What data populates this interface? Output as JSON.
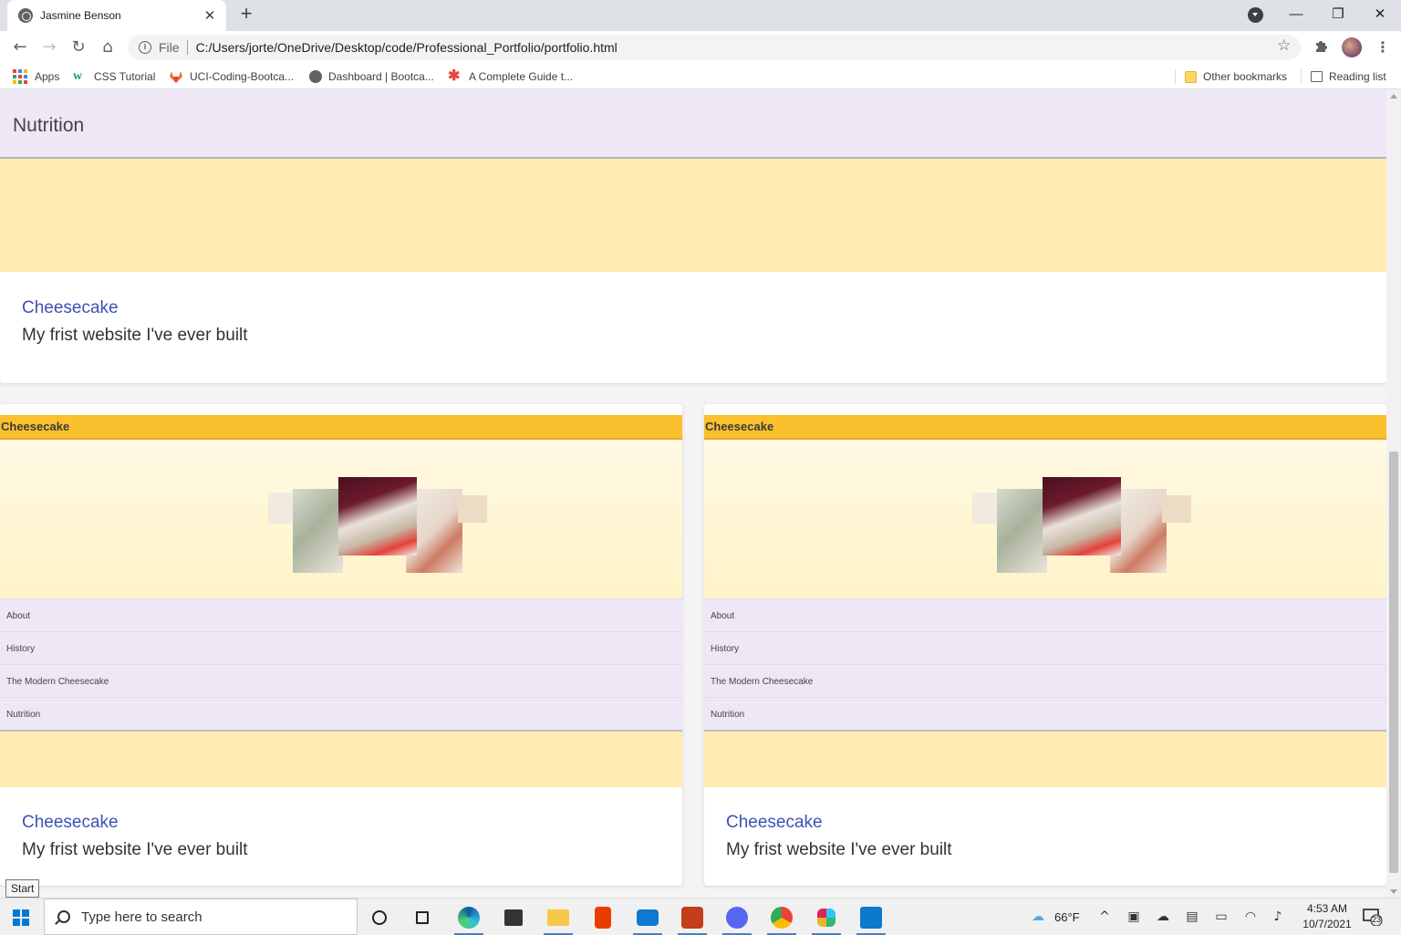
{
  "browser": {
    "tab_title": "Jasmine Benson",
    "tab_close": "✕",
    "new_tab": "+",
    "address_scheme": "File",
    "address_url": "C:/Users/jorte/OneDrive/Desktop/code/Professional_Portfolio/portfolio.html",
    "window_controls": {
      "minimize": "—",
      "restore": "❐",
      "close": "✕"
    }
  },
  "bookmarks": {
    "items": [
      {
        "label": "Apps",
        "icon": "apps-grid-icon"
      },
      {
        "label": "CSS Tutorial",
        "icon": "w3schools-icon"
      },
      {
        "label": "UCI-Coding-Bootca...",
        "icon": "gitlab-icon"
      },
      {
        "label": "Dashboard | Bootca...",
        "icon": "globe-icon"
      },
      {
        "label": "A Complete Guide t...",
        "icon": "asterisk-icon"
      }
    ],
    "other": "Other bookmarks",
    "reading_list": "Reading list"
  },
  "page": {
    "top_card": {
      "nav_label": "Nutrition",
      "title": "Cheesecake",
      "subtitle": "My frist website I've ever built"
    },
    "cards": [
      {
        "thumb_header": "Cheesecake",
        "thumb_nav": [
          "About",
          "History",
          "The Modern Cheesecake",
          "Nutrition"
        ],
        "title": "Cheesecake",
        "subtitle": "My frist website I've ever built"
      },
      {
        "thumb_header": "Cheesecake",
        "thumb_nav": [
          "About",
          "History",
          "The Modern Cheesecake",
          "Nutrition"
        ],
        "title": "Cheesecake",
        "subtitle": "My frist website I've ever built"
      }
    ]
  },
  "taskbar": {
    "start_tooltip": "Start",
    "search_placeholder": "Type here to search",
    "weather": "66°F",
    "time": "4:53 AM",
    "date": "10/7/2021",
    "notification_count": "23",
    "apps": [
      "cortana",
      "task-view",
      "edge",
      "store",
      "file-explorer",
      "office",
      "mail",
      "powerpoint",
      "discord",
      "chrome",
      "slack",
      "vscode"
    ]
  },
  "colors": {
    "nav_lavender": "#ede7f6",
    "yellow_band": "#ffecb3",
    "header_gold": "#fbc02d",
    "link_blue": "#3f51b5"
  }
}
